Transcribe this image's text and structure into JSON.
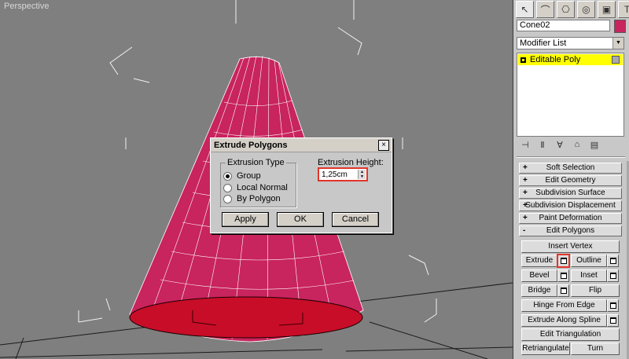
{
  "viewport": {
    "label": "Perspective"
  },
  "dialog": {
    "title": "Extrude Polygons",
    "close_icon": "×",
    "extrusion_type_label": "Extrusion Type",
    "options": [
      "Group",
      "Local Normal",
      "By Polygon"
    ],
    "selected_option": "Group",
    "height_label": "Extrusion Height:",
    "height_value": "1,25cm",
    "buttons": {
      "apply": "Apply",
      "ok": "OK",
      "cancel": "Cancel"
    }
  },
  "panel": {
    "tabs": [
      "select-icon",
      "create-icon",
      "hierarchy-icon",
      "motion-icon",
      "display-icon",
      "utilities-icon"
    ],
    "object_name": "Cone02",
    "object_color": "#c8245d",
    "modifier_list": "Modifier List",
    "stack_items": [
      {
        "label": "Editable Poly",
        "highlight_color": "#ffff00"
      }
    ],
    "rollouts": [
      {
        "sign": "+",
        "label": "Soft Selection"
      },
      {
        "sign": "+",
        "label": "Edit Geometry"
      },
      {
        "sign": "+",
        "label": "Subdivision Surface"
      },
      {
        "sign": "+",
        "label": "Subdivision Displacement"
      },
      {
        "sign": "+",
        "label": "Paint Deformation"
      },
      {
        "sign": "-",
        "label": "Edit Polygons"
      }
    ],
    "edit_polygons": {
      "insert_vertex": "Insert Vertex",
      "extrude": "Extrude",
      "outline": "Outline",
      "bevel": "Bevel",
      "inset": "Inset",
      "bridge": "Bridge",
      "flip": "Flip",
      "hinge_from_edge": "Hinge From Edge",
      "extrude_along_spline": "Extrude Along Spline",
      "edit_triangulation": "Edit Triangulation",
      "retriangulate": "Retriangulate",
      "turn": "Turn"
    }
  },
  "colors": {
    "accent_red": "#e2342a",
    "cone": "#c8245d",
    "selection": "#ffff00"
  }
}
